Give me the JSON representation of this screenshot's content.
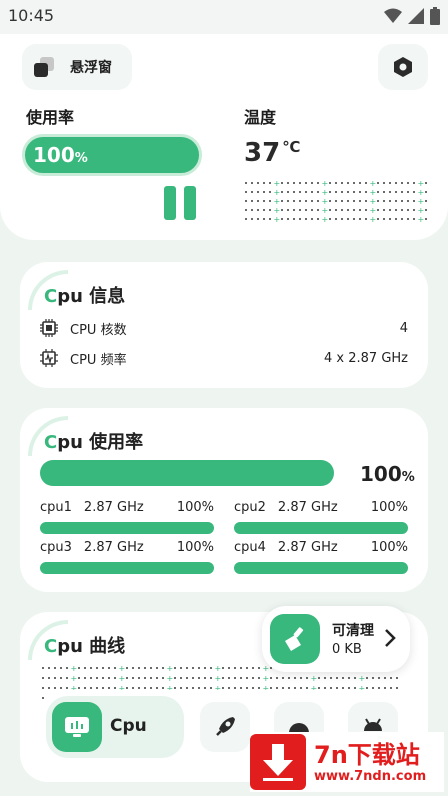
{
  "status_bar": {
    "time": "10:45"
  },
  "header": {
    "float_window_label": "悬浮窗",
    "usage": {
      "title": "使用率",
      "value": "100",
      "unit": "%",
      "level": 1.0
    },
    "temperature": {
      "title": "温度",
      "value": "37",
      "unit": "℃"
    }
  },
  "cpu_info": {
    "title_accent": "C",
    "title_rest": "pu 信息",
    "rows": [
      {
        "icon": "chip-icon",
        "label": "CPU 核数",
        "value": "4"
      },
      {
        "icon": "frequency-icon",
        "label": "CPU 频率",
        "value": "4 x 2.87 GHz"
      }
    ]
  },
  "cpu_usage": {
    "title_accent": "C",
    "title_rest": "pu 使用率",
    "total_value": "100",
    "total_unit": "%",
    "total_level": 1.0,
    "cores": [
      {
        "name": "cpu1",
        "freq": "2.87 GHz",
        "pct": "100%",
        "level": 1.0
      },
      {
        "name": "cpu2",
        "freq": "2.87 GHz",
        "pct": "100%",
        "level": 1.0
      },
      {
        "name": "cpu3",
        "freq": "2.87 GHz",
        "pct": "100%",
        "level": 1.0
      },
      {
        "name": "cpu4",
        "freq": "2.87 GHz",
        "pct": "100%",
        "level": 1.0
      }
    ]
  },
  "cpu_curve": {
    "title_accent": "C",
    "title_rest": "pu 曲线"
  },
  "cleaner": {
    "title": "可清理",
    "size": "0 KB"
  },
  "nav": {
    "active_label": "Cpu"
  },
  "watermark": {
    "brand": "7n下载站",
    "url": "www.7ndn.com"
  },
  "colors": {
    "accent": "#38b87c",
    "accent_light": "#c9ecd9",
    "background": "#eef5f1"
  }
}
